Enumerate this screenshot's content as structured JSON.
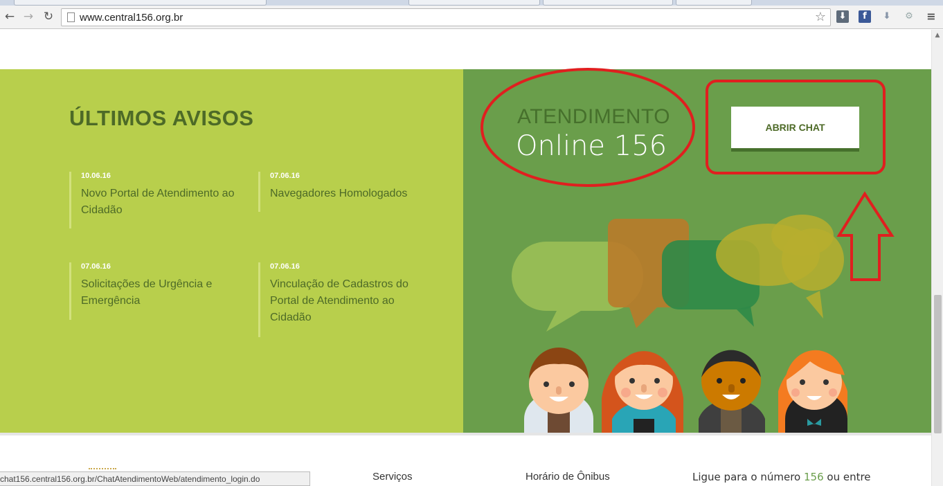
{
  "browser": {
    "url": "www.central156.org.br",
    "back_icon": "back-arrow-icon",
    "forward_icon": "forward-arrow-icon",
    "reload_icon": "reload-icon",
    "bookmark_icon": "star-icon",
    "menu_icon": "hamburger-menu-icon"
  },
  "avisos": {
    "title": "ÚLTIMOS AVISOS",
    "items": [
      {
        "date": "10.06.16",
        "title": "Novo Portal de Atendimento ao Cidadão"
      },
      {
        "date": "07.06.16",
        "title": "Navegadores Homologados"
      },
      {
        "date": "07.06.16",
        "title": "Solicitações de Urgência e Emergência"
      },
      {
        "date": "07.06.16",
        "title": "Vinculação de Cadastros do Portal de Atendimento ao Cidadão"
      }
    ]
  },
  "atendimento": {
    "title": "ATENDIMENTO",
    "subtitle": "Online 156",
    "chat_button": "ABRIR CHAT"
  },
  "footer": {
    "col1": "Serviços",
    "col2": "Horário de Ônibus",
    "contact_pre": "Ligue para o número ",
    "contact_num": "156",
    "contact_post": " ou entre"
  },
  "status_url": "chat156.central156.org.br/ChatAtendimentoWeb/atendimento_login.do",
  "colors": {
    "lime_panel": "#b8cf4c",
    "green_panel": "#6a9e4b",
    "dark_green_text": "#4d6a27",
    "annotation_red": "#e01f1f"
  }
}
